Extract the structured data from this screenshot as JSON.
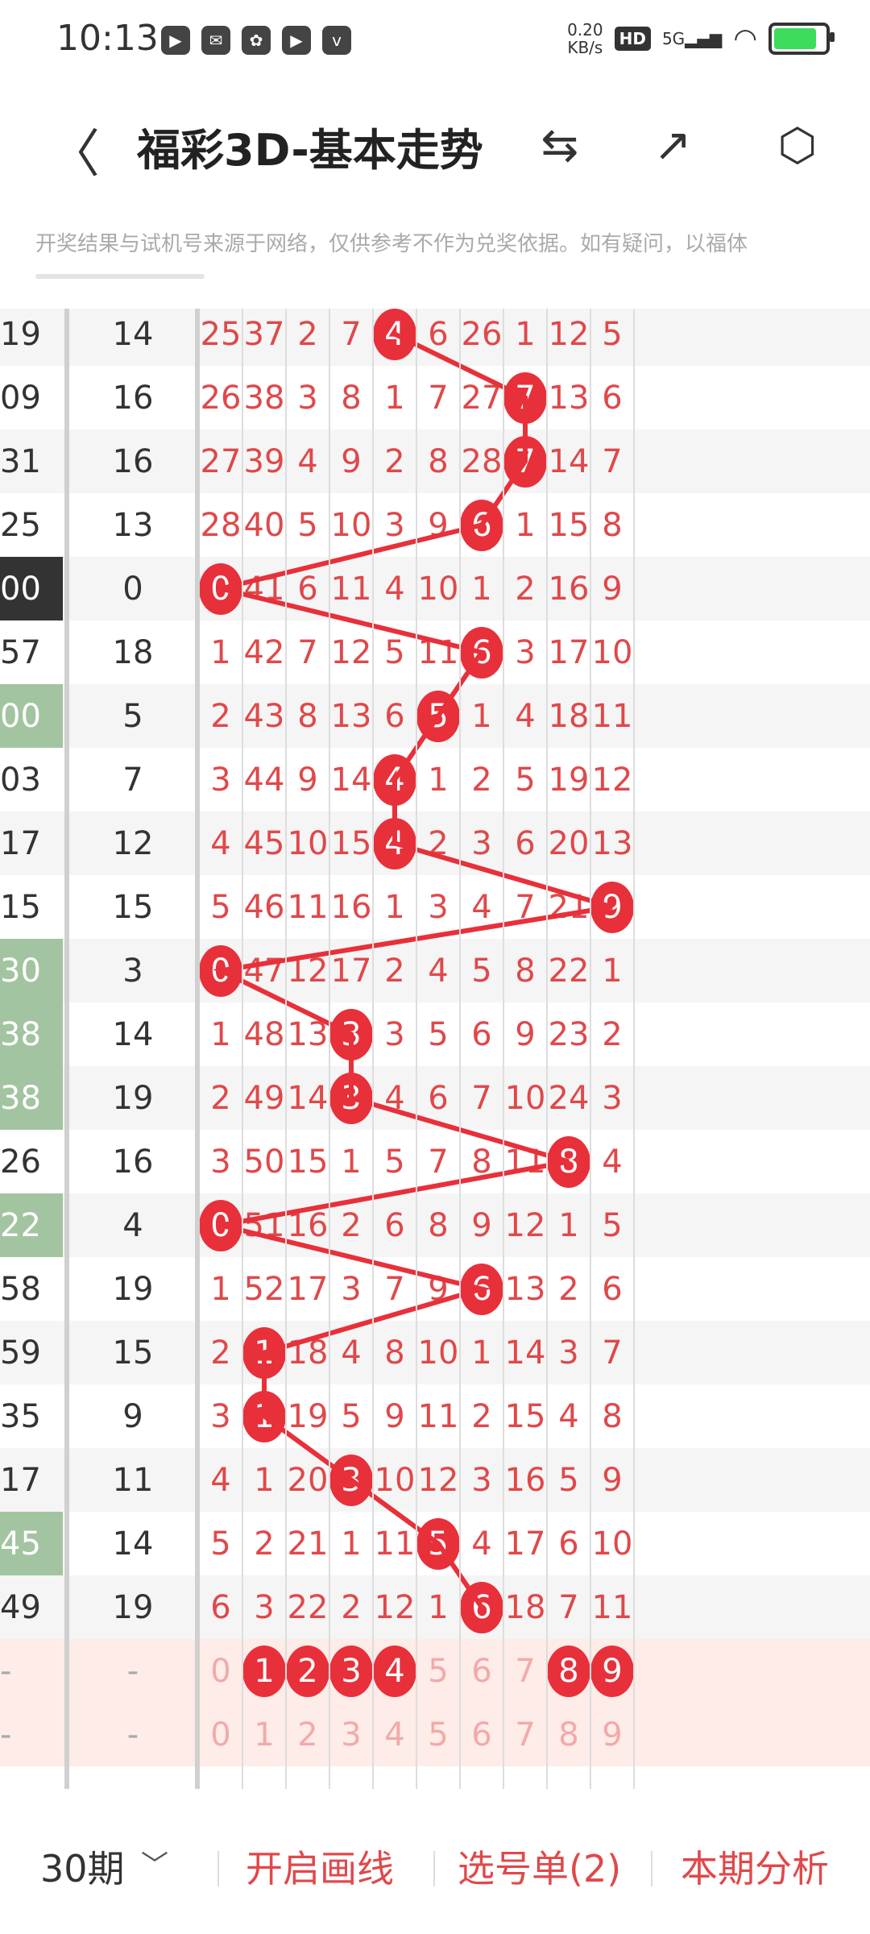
{
  "status_bar": {
    "time": "10:13",
    "speed": "0.20",
    "speed_unit": "KB/s",
    "hd": "HD",
    "network": "5G",
    "icons": [
      "video-app-icon",
      "notification-icon",
      "wechat-icon",
      "player-icon",
      "vivo-icon"
    ],
    "icon_glyphs": [
      "▶",
      "✉",
      "✿",
      "▶",
      "v"
    ],
    "battery_level": 0.9
  },
  "header": {
    "title": "福彩3D-基本走势",
    "back_glyph": "〈",
    "icons": [
      "swap-chart-icon",
      "share-icon",
      "settings-icon"
    ],
    "icon_glyphs": [
      "⇆",
      "↗",
      "⬡"
    ]
  },
  "notice": "开奖结果与试机号来源于网络，仅供参考不作为兑奖依据。如有疑问，以福体",
  "table": {
    "rows": [
      {
        "c0": "19",
        "style": "",
        "c1": "14",
        "cells": [
          "25",
          "37",
          "2",
          "7",
          "4",
          "6",
          "26",
          "1",
          "12",
          "5"
        ],
        "hit": 4
      },
      {
        "c0": "09",
        "style": "",
        "c1": "16",
        "cells": [
          "26",
          "38",
          "3",
          "8",
          "1",
          "7",
          "27",
          "7",
          "13",
          "6"
        ],
        "hit": 7
      },
      {
        "c0": "31",
        "style": "",
        "c1": "16",
        "cells": [
          "27",
          "39",
          "4",
          "9",
          "2",
          "8",
          "28",
          "7",
          "14",
          "7"
        ],
        "hit": 7
      },
      {
        "c0": "25",
        "style": "",
        "c1": "13",
        "cells": [
          "28",
          "40",
          "5",
          "10",
          "3",
          "9",
          "6",
          "1",
          "15",
          "8"
        ],
        "hit": 6
      },
      {
        "c0": "00",
        "style": "dark",
        "c1": "0",
        "cells": [
          "0",
          "41",
          "6",
          "11",
          "4",
          "10",
          "1",
          "2",
          "16",
          "9"
        ],
        "hit": 0
      },
      {
        "c0": "57",
        "style": "",
        "c1": "18",
        "cells": [
          "1",
          "42",
          "7",
          "12",
          "5",
          "11",
          "6",
          "3",
          "17",
          "10"
        ],
        "hit": 6
      },
      {
        "c0": "00",
        "style": "green",
        "c1": "5",
        "cells": [
          "2",
          "43",
          "8",
          "13",
          "6",
          "5",
          "1",
          "4",
          "18",
          "11"
        ],
        "hit": 5
      },
      {
        "c0": "03",
        "style": "",
        "c1": "7",
        "cells": [
          "3",
          "44",
          "9",
          "14",
          "4",
          "1",
          "2",
          "5",
          "19",
          "12"
        ],
        "hit": 4
      },
      {
        "c0": "17",
        "style": "",
        "c1": "12",
        "cells": [
          "4",
          "45",
          "10",
          "15",
          "4",
          "2",
          "3",
          "6",
          "20",
          "13"
        ],
        "hit": 4
      },
      {
        "c0": "15",
        "style": "",
        "c1": "15",
        "cells": [
          "5",
          "46",
          "11",
          "16",
          "1",
          "3",
          "4",
          "7",
          "21",
          "9"
        ],
        "hit": 9
      },
      {
        "c0": "30",
        "style": "green",
        "c1": "3",
        "cells": [
          "0",
          "47",
          "12",
          "17",
          "2",
          "4",
          "5",
          "8",
          "22",
          "1"
        ],
        "hit": 0
      },
      {
        "c0": "38",
        "style": "green",
        "c1": "14",
        "cells": [
          "1",
          "48",
          "13",
          "3",
          "3",
          "5",
          "6",
          "9",
          "23",
          "2"
        ],
        "hit": 3
      },
      {
        "c0": "38",
        "style": "green",
        "c1": "19",
        "cells": [
          "2",
          "49",
          "14",
          "3",
          "4",
          "6",
          "7",
          "10",
          "24",
          "3"
        ],
        "hit": 3
      },
      {
        "c0": "26",
        "style": "",
        "c1": "16",
        "cells": [
          "3",
          "50",
          "15",
          "1",
          "5",
          "7",
          "8",
          "11",
          "8",
          "4"
        ],
        "hit": 8
      },
      {
        "c0": "22",
        "style": "green",
        "c1": "4",
        "cells": [
          "0",
          "51",
          "16",
          "2",
          "6",
          "8",
          "9",
          "12",
          "1",
          "5"
        ],
        "hit": 0
      },
      {
        "c0": "58",
        "style": "",
        "c1": "19",
        "cells": [
          "1",
          "52",
          "17",
          "3",
          "7",
          "9",
          "6",
          "13",
          "2",
          "6"
        ],
        "hit": 6
      },
      {
        "c0": "59",
        "style": "",
        "c1": "15",
        "cells": [
          "2",
          "1",
          "18",
          "4",
          "8",
          "10",
          "1",
          "14",
          "3",
          "7"
        ],
        "hit": 1
      },
      {
        "c0": "35",
        "style": "",
        "c1": "9",
        "cells": [
          "3",
          "1",
          "19",
          "5",
          "9",
          "11",
          "2",
          "15",
          "4",
          "8"
        ],
        "hit": 1
      },
      {
        "c0": "17",
        "style": "",
        "c1": "11",
        "cells": [
          "4",
          "1",
          "20",
          "3",
          "10",
          "12",
          "3",
          "16",
          "5",
          "9"
        ],
        "hit": 3
      },
      {
        "c0": "45",
        "style": "green",
        "c1": "14",
        "cells": [
          "5",
          "2",
          "21",
          "1",
          "11",
          "5",
          "4",
          "17",
          "6",
          "10"
        ],
        "hit": 5
      },
      {
        "c0": "49",
        "style": "",
        "c1": "19",
        "cells": [
          "6",
          "3",
          "22",
          "2",
          "12",
          "1",
          "6",
          "18",
          "7",
          "11"
        ],
        "hit": 6
      }
    ],
    "summary_rows": [
      {
        "c0": "-",
        "c1": "-",
        "cells": [
          "0",
          "1",
          "2",
          "3",
          "4",
          "5",
          "6",
          "7",
          "8",
          "9"
        ],
        "balls": [
          1,
          2,
          3,
          4,
          8,
          9
        ]
      },
      {
        "c0": "-",
        "c1": "-",
        "cells": [
          "0",
          "1",
          "2",
          "3",
          "4",
          "5",
          "6",
          "7",
          "8",
          "9"
        ],
        "balls": []
      }
    ]
  },
  "bottom_bar": {
    "period": "30期",
    "chevron": "﹀",
    "draw_lines": "开启画线",
    "pick_list": "选号单(2)",
    "analysis": "本期分析"
  }
}
